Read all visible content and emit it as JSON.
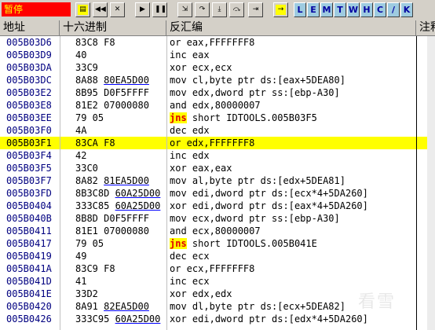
{
  "toolbar": {
    "status": "暂停",
    "letters": [
      "L",
      "E",
      "M",
      "T",
      "W",
      "H",
      "C",
      "/",
      "K"
    ]
  },
  "columns": {
    "address": "地址",
    "hex": "十六进制",
    "disasm": "反汇编",
    "comment": "注释"
  },
  "rows": [
    {
      "addr": "005B03D6",
      "hex": "83C8 F8",
      "asm": "or eax,FFFFFFF8"
    },
    {
      "addr": "005B03D9",
      "hex": "40",
      "asm": "inc eax"
    },
    {
      "addr": "005B03DA",
      "hex": "33C9",
      "asm": "xor ecx,ecx"
    },
    {
      "addr": "005B03DC",
      "hex_a": "8A88 ",
      "hex_u": "80EA5D00",
      "asm": "mov cl,byte ptr ds:[eax+5DEA80]"
    },
    {
      "addr": "005B03E2",
      "hex": "8B95 D0F5FFFF",
      "asm": "mov edx,dword ptr ss:[ebp-A30]"
    },
    {
      "addr": "005B03E8",
      "hex": "81E2 07000080",
      "asm": "and edx,80000007"
    },
    {
      "addr": "005B03EE",
      "hex": "79 05",
      "jmp": "jns",
      "asm_rest": " short IDTOOLS.005B03F5"
    },
    {
      "addr": "005B03F0",
      "hex": "4A",
      "asm": "dec edx"
    },
    {
      "addr": "005B03F1",
      "hex": "83CA F8",
      "asm": "or edx,FFFFFFF8",
      "hl": true
    },
    {
      "addr": "005B03F4",
      "hex": "42",
      "asm": "inc edx"
    },
    {
      "addr": "005B03F5",
      "hex": "33C0",
      "asm": "xor eax,eax"
    },
    {
      "addr": "005B03F7",
      "hex_a": "8A82 ",
      "hex_u": "81EA5D00",
      "asm": "mov al,byte ptr ds:[edx+5DEA81]"
    },
    {
      "addr": "005B03FD",
      "hex_a": "8B3C8D ",
      "hex_u": "60A25D00",
      "asm": "mov edi,dword ptr ds:[ecx*4+5DA260]"
    },
    {
      "addr": "005B0404",
      "hex_a": "333C85 ",
      "hex_u": "60A25D00",
      "asm": "xor edi,dword ptr ds:[eax*4+5DA260]"
    },
    {
      "addr": "005B040B",
      "hex": "8B8D D0F5FFFF",
      "asm": "mov ecx,dword ptr ss:[ebp-A30]"
    },
    {
      "addr": "005B0411",
      "hex": "81E1 07000080",
      "asm": "and ecx,80000007"
    },
    {
      "addr": "005B0417",
      "hex": "79 05",
      "jmp": "jns",
      "asm_rest": " short IDTOOLS.005B041E"
    },
    {
      "addr": "005B0419",
      "hex": "49",
      "asm": "dec ecx"
    },
    {
      "addr": "005B041A",
      "hex": "83C9 F8",
      "asm": "or ecx,FFFFFFF8"
    },
    {
      "addr": "005B041D",
      "hex": "41",
      "asm": "inc ecx"
    },
    {
      "addr": "005B041E",
      "hex": "33D2",
      "asm": "xor edx,edx"
    },
    {
      "addr": "005B0420",
      "hex_a": "8A91 ",
      "hex_u": "82EA5D00",
      "asm": "mov dl,byte ptr ds:[ecx+5DEA82]"
    },
    {
      "addr": "005B0426",
      "hex_a": "333C95 ",
      "hex_u": "60A25D00",
      "asm": "xor edi,dword ptr ds:[edx*4+5DA260]"
    }
  ],
  "watermark": "看雪"
}
